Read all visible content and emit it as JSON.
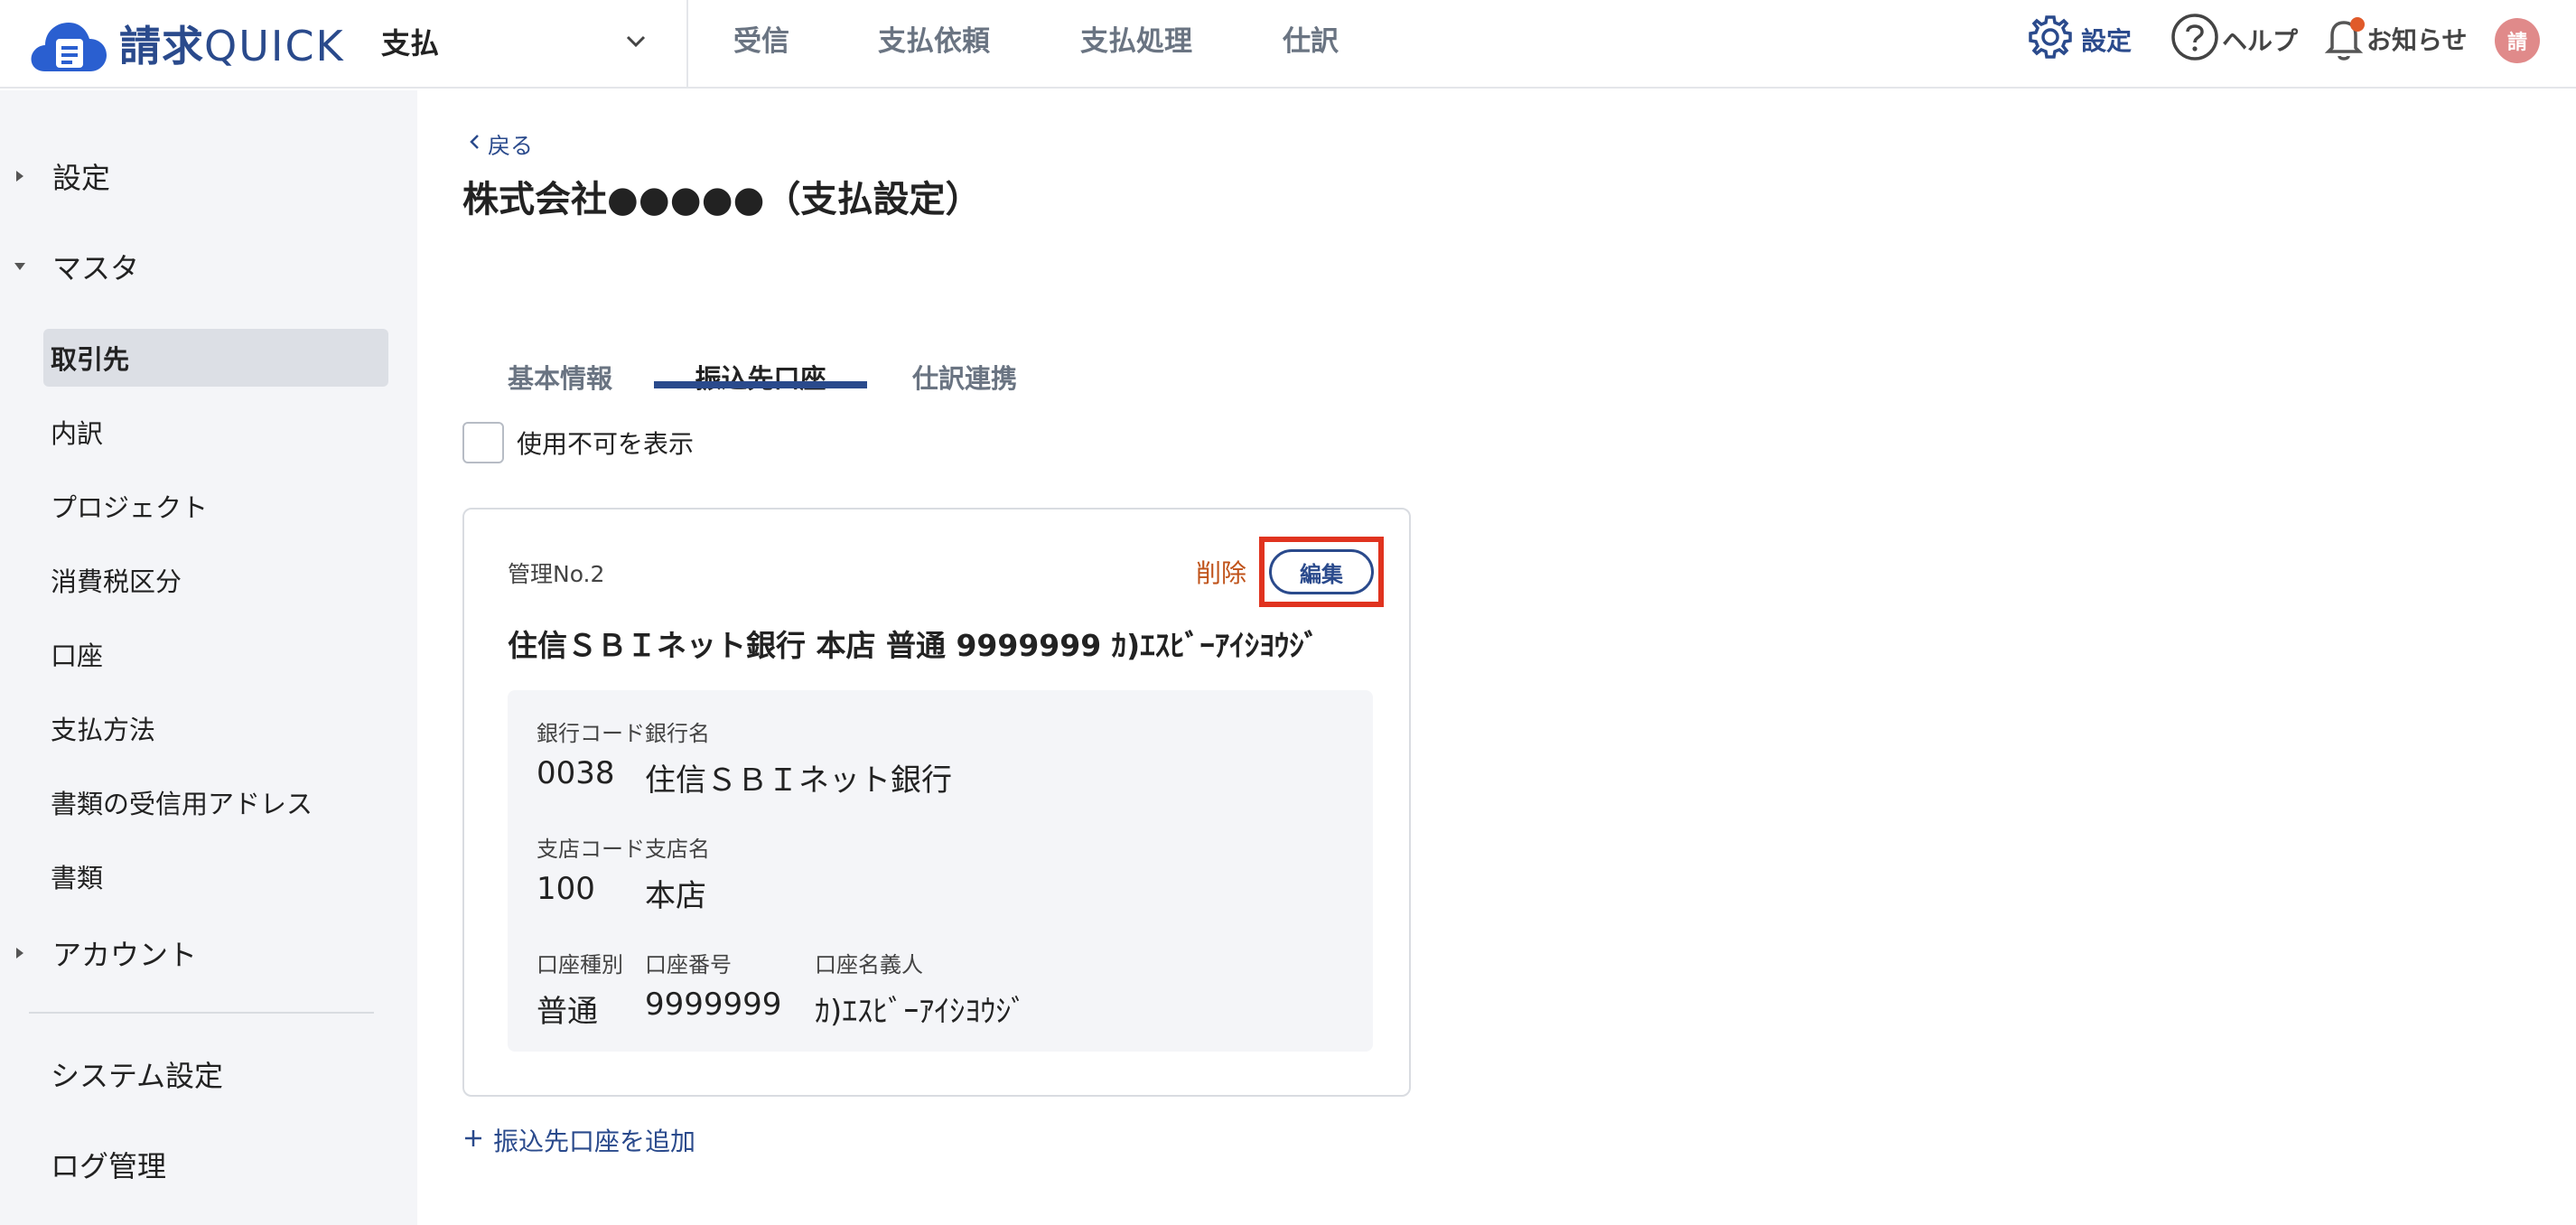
{
  "header": {
    "logo_prefix": "請求",
    "logo_suffix": "QUICK",
    "module": "支払",
    "nav": [
      "受信",
      "支払依頼",
      "支払処理",
      "仕訳"
    ],
    "settings": "設定",
    "help": "ヘルプ",
    "notices": "お知らせ",
    "avatar": "請",
    "colors": {
      "brand": "#2a4a8c",
      "notice_dot": "#e05a2a",
      "avatar_bg": "#e08a8a"
    }
  },
  "sidebar": {
    "groups": {
      "settings": "設定",
      "master": "マスタ",
      "account": "アカウント"
    },
    "items": [
      "取引先",
      "内訳",
      "プロジェクト",
      "消費税区分",
      "口座",
      "支払方法",
      "書類の受信用アドレス",
      "書類"
    ],
    "active_item": "取引先",
    "bottom": [
      "システム設定",
      "ログ管理"
    ]
  },
  "main": {
    "back": "戻る",
    "title": "株式会社●●●●●（支払設定）",
    "tabs": [
      "基本情報",
      "振込先口座",
      "仕訳連携"
    ],
    "active_tab": "振込先口座",
    "show_disabled_label": "使用不可を表示",
    "card": {
      "management_no": "管理No.2",
      "delete_label": "削除",
      "edit_label": "編集",
      "summary": "住信ＳＢＩネット銀行 本店 普通 9999999 ｶ)ｴｽﾋﾞｰｱｲｼﾖｳｼﾞ",
      "bank_label": "銀行コード銀行名",
      "bank_code": "0038",
      "bank_name": "住信ＳＢＩネット銀行",
      "branch_label": "支店コード支店名",
      "branch_code": "100",
      "branch_name": "本店",
      "type_label": "口座種別",
      "type_value": "普通",
      "number_label": "口座番号",
      "number_value": "9999999",
      "holder_label": "口座名義人",
      "holder_value": "ｶ)ｴｽﾋﾞｰｱｲｼﾖｳｼﾞ"
    },
    "add_account": "振込先口座を追加"
  }
}
